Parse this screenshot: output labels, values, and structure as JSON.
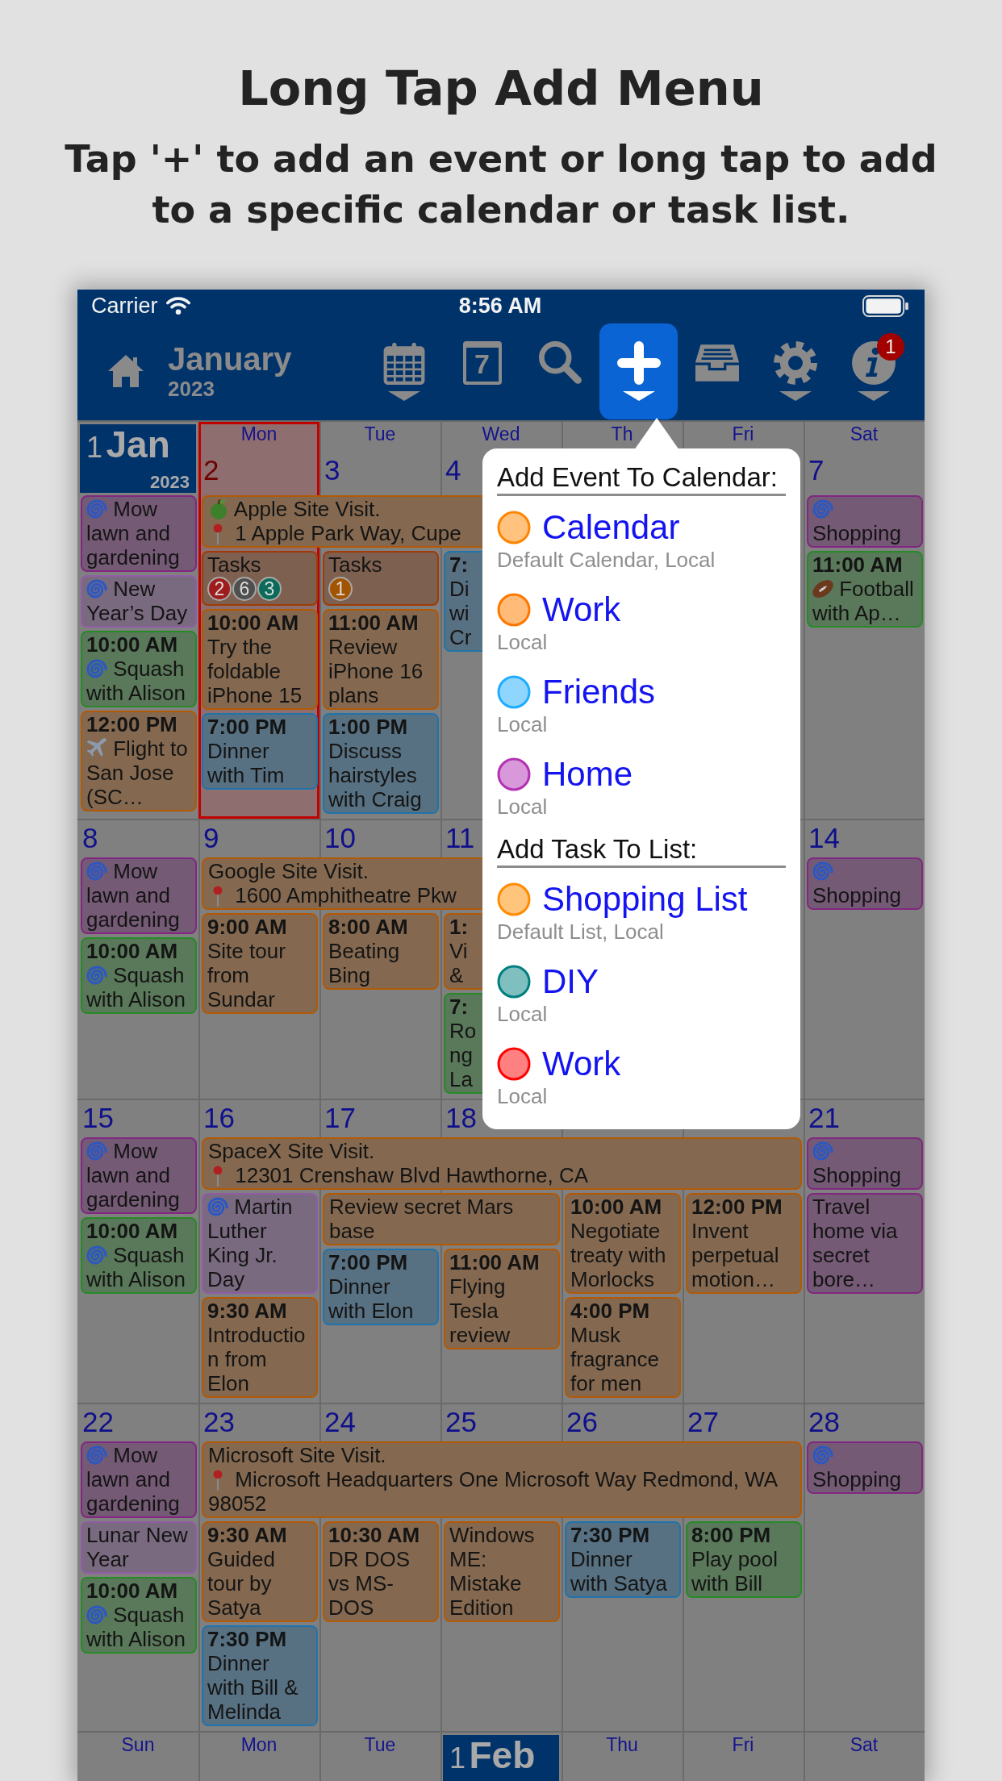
{
  "promo": {
    "title": "Long Tap Add Menu",
    "subtitle": "Tap '+' to add an event or long tap to add to a specific calendar or task list."
  },
  "status_bar": {
    "carrier": "Carrier",
    "time": "8:56 AM"
  },
  "toolbar": {
    "month": "January",
    "year": "2023",
    "buttons": [
      {
        "kind": "month-grid",
        "dropdown": true,
        "selected": false
      },
      {
        "kind": "day",
        "label": "7",
        "dropdown": false,
        "selected": false
      },
      {
        "kind": "search",
        "dropdown": false,
        "selected": false
      },
      {
        "kind": "add",
        "dropdown": true,
        "selected": true
      },
      {
        "kind": "inbox",
        "dropdown": false,
        "selected": false
      },
      {
        "kind": "settings",
        "dropdown": true,
        "selected": false
      },
      {
        "kind": "info",
        "dropdown": true,
        "selected": false,
        "badge": "1"
      }
    ]
  },
  "calendar": {
    "weeks": [
      {
        "days": [
          {
            "kind": "month-start",
            "day": "1",
            "month": "Jan",
            "year": "2023",
            "events": [
              {
                "kind": "cyclone-event",
                "title": "Mow lawn and gardening",
                "color": "#755a75"
              },
              {
                "kind": "cyclone-event",
                "title": "New Year’s Day",
                "color": "#7a6a80"
              },
              {
                "kind": "cyclone-event",
                "time": "10:00 AM",
                "title": "Squash with Alison",
                "color": "#5a785a"
              },
              {
                "kind": "airplane-event",
                "time": "12:00 PM",
                "title": "Flight to San Jose (SC…",
                "color": "#846950"
              }
            ]
          },
          {
            "kind": "day",
            "weekday": "Mon",
            "date": "2",
            "today": true,
            "banners": [
              {
                "kind": "apple-banner",
                "title": "Apple Site Visit.",
                "address": "1 Apple Park Way, Cupe",
                "color": "#846950"
              }
            ],
            "events": [
              {
                "kind": "tasks",
                "label": "Tasks",
                "color": "#7e6050",
                "counts": [
                  {
                    "count": "2",
                    "color": "#a01c1c"
                  },
                  {
                    "count": "6",
                    "color": "#4f4f4f"
                  },
                  {
                    "count": "3",
                    "color": "#0b6b5b"
                  }
                ]
              },
              {
                "kind": "event",
                "time": "10:00 AM",
                "title": "Try the foldable iPhone 15",
                "color": "#846950"
              },
              {
                "kind": "event",
                "time": "7:00 PM",
                "title": "Dinner with Tim",
                "color": "#587182"
              }
            ]
          },
          {
            "kind": "day",
            "weekday": "Tue",
            "date": "3",
            "today": false,
            "banners": [
              {
                "kind": "continued"
              }
            ],
            "events": [
              {
                "kind": "tasks",
                "label": "Tasks",
                "color": "#7e6050",
                "counts": [
                  {
                    "count": "1",
                    "color": "#a35400"
                  }
                ]
              },
              {
                "kind": "event",
                "time": "11:00 AM",
                "title": "Review iPhone 16 plans",
                "color": "#846950"
              },
              {
                "kind": "event",
                "time": "1:00 PM",
                "title": "Discuss hairstyles with Craig",
                "color": "#587182"
              }
            ]
          },
          {
            "kind": "day",
            "weekday": "Wed",
            "date": "4",
            "today": false,
            "banners": [
              {
                "kind": "continued"
              }
            ],
            "events": [
              {
                "kind": "event",
                "time": "7:",
                "title": "Di\nwi\nCr",
                "color": "#587182"
              }
            ]
          },
          {
            "kind": "day",
            "weekday": "Th"
          },
          {
            "kind": "day",
            "weekday": "Fri"
          },
          {
            "kind": "day",
            "weekday": "Sat",
            "date": "7",
            "today": false,
            "events": [
              {
                "kind": "cyclone-event",
                "title": "Shopping",
                "color": "#755a75"
              },
              {
                "kind": "football-event",
                "time": "11:00 AM",
                "title": "Football with Ap…",
                "color": "#5a785a"
              }
            ]
          }
        ]
      },
      {
        "days": [
          {
            "kind": "day",
            "date": "8",
            "today": false,
            "events": [
              {
                "kind": "cyclone-event",
                "title": "Mow lawn and gardening",
                "color": "#755a75"
              },
              {
                "kind": "cyclone-event",
                "time": "10:00 AM",
                "title": "Squash with Alison",
                "color": "#5a785a"
              }
            ]
          },
          {
            "kind": "day",
            "date": "9",
            "today": false,
            "banners": [
              {
                "kind": "banner",
                "title": "Google Site Visit.",
                "address": "1600 Amphitheatre Pkw",
                "color": "#846950"
              }
            ],
            "events": [
              {
                "kind": "event",
                "time": "9:00 AM",
                "title": "Site tour from Sundar",
                "color": "#846950"
              }
            ]
          },
          {
            "kind": "day",
            "date": "10",
            "today": false,
            "banners": [
              {
                "kind": "continued"
              }
            ],
            "events": [
              {
                "kind": "event",
                "time": "8:00 AM",
                "title": "Beating Bing",
                "color": "#846950"
              }
            ]
          },
          {
            "kind": "day",
            "date": "11",
            "today": false,
            "banners": [
              {
                "kind": "continued"
              }
            ],
            "events": [
              {
                "kind": "event",
                "time": "1:",
                "title": "Vi\n&",
                "color": "#846950"
              },
              {
                "kind": "event",
                "time": "7:",
                "title": "Ro\nng\nLa",
                "color": "#5a785a"
              }
            ]
          },
          {
            "kind": "day"
          },
          {
            "kind": "day"
          },
          {
            "kind": "day",
            "date": "14",
            "today": false,
            "events": [
              {
                "kind": "cyclone-event",
                "title": "Shopping",
                "color": "#755a75"
              }
            ]
          }
        ]
      },
      {
        "days": [
          {
            "kind": "day",
            "date": "15",
            "today": false,
            "events": [
              {
                "kind": "cyclone-event",
                "title": "Mow lawn and gardening",
                "color": "#755a75"
              },
              {
                "kind": "cyclone-event",
                "time": "10:00 AM",
                "title": "Squash with Alison",
                "color": "#5a785a"
              }
            ]
          },
          {
            "kind": "day",
            "date": "16",
            "today": false,
            "banners": [
              {
                "kind": "banner",
                "title": "SpaceX Site Visit.",
                "address": "12301 Crenshaw Blvd Hawthorne, CA",
                "color": "#846950"
              }
            ],
            "events": [
              {
                "kind": "cyclone-event",
                "title": "Martin Luther King Jr. Day",
                "color": "#7a6a80"
              },
              {
                "kind": "event",
                "time": "9:30 AM",
                "title": "Introduction from Elon",
                "color": "#846950"
              }
            ]
          },
          {
            "kind": "day",
            "date": "17",
            "today": false,
            "banners": [
              {
                "kind": "continued"
              },
              {
                "kind": "banner",
                "title": "Review secret Mars base",
                "color": "#846950"
              }
            ],
            "events": [
              {
                "kind": "event",
                "time": "7:00 PM",
                "title": "Dinner with Elon",
                "color": "#587182"
              }
            ]
          },
          {
            "kind": "day",
            "date": "18",
            "today": false,
            "banners": [
              {
                "kind": "continued"
              },
              {
                "kind": "continued"
              }
            ],
            "events": [
              {
                "kind": "event",
                "time": "11:00 AM",
                "title": "Flying Tesla review",
                "color": "#846950"
              }
            ]
          },
          {
            "kind": "day",
            "banners": [
              {
                "kind": "continued"
              }
            ],
            "events": [
              {
                "kind": "event",
                "time": "10:00 AM",
                "title": "Negotiate treaty with Morlocks",
                "color": "#846950"
              },
              {
                "kind": "event",
                "time": "4:00 PM",
                "title": "Musk fragrance for men",
                "color": "#846950"
              }
            ]
          },
          {
            "kind": "day",
            "banners": [
              {
                "kind": "continued"
              }
            ],
            "events": [
              {
                "kind": "event",
                "time": "12:00 PM",
                "title": "Invent perpetual motion…",
                "color": "#846950"
              }
            ]
          },
          {
            "kind": "day",
            "date": "21",
            "today": false,
            "events": [
              {
                "kind": "cyclone-event",
                "title": "Shopping",
                "color": "#755a75"
              },
              {
                "kind": "event",
                "title": "Travel home via secret bore…",
                "color": "#755a75"
              }
            ]
          }
        ]
      },
      {
        "days": [
          {
            "kind": "day",
            "date": "22",
            "today": false,
            "events": [
              {
                "kind": "cyclone-event",
                "title": "Mow lawn and gardening",
                "color": "#755a75"
              },
              {
                "kind": "event",
                "title": "Lunar New Year",
                "color": "#7a6a80"
              },
              {
                "kind": "cyclone-event",
                "time": "10:00 AM",
                "title": "Squash with Alison",
                "color": "#5a785a"
              }
            ]
          },
          {
            "kind": "day",
            "date": "23",
            "today": false,
            "banners": [
              {
                "kind": "banner",
                "title": "Microsoft Site Visit.",
                "address": "Microsoft Headquarters One Microsoft Way Redmond, WA 98052",
                "color": "#846950"
              }
            ],
            "events": [
              {
                "kind": "event",
                "time": "9:30 AM",
                "title": "Guided tour by Satya",
                "color": "#846950"
              },
              {
                "kind": "event",
                "time": "7:30 PM",
                "title": "Dinner with Bill & Melinda",
                "color": "#587182"
              }
            ]
          },
          {
            "kind": "day",
            "date": "24",
            "today": false,
            "banners": [
              {
                "kind": "continued"
              }
            ],
            "events": [
              {
                "kind": "event",
                "time": "10:30 AM",
                "title": "DR DOS vs MS-DOS",
                "color": "#846950"
              }
            ]
          },
          {
            "kind": "day",
            "date": "25",
            "today": false,
            "banners": [
              {
                "kind": "continued"
              }
            ],
            "events": [
              {
                "kind": "event",
                "title": "Windows ME: Mistake Edition",
                "color": "#846950"
              }
            ]
          },
          {
            "kind": "day",
            "date": "26",
            "today": false,
            "banners": [
              {
                "kind": "continued"
              }
            ],
            "events": [
              {
                "kind": "event",
                "time": "7:30 PM",
                "title": "Dinner with Satya",
                "color": "#587182"
              }
            ]
          },
          {
            "kind": "day",
            "date": "27",
            "today": false,
            "banners": [
              {
                "kind": "continued"
              }
            ],
            "events": [
              {
                "kind": "event",
                "time": "8:00 PM",
                "title": "Play pool with Bill",
                "color": "#5a785a"
              }
            ]
          },
          {
            "kind": "day",
            "date": "28",
            "today": false,
            "events": [
              {
                "kind": "cyclone-event",
                "title": "Shopping",
                "color": "#755a75"
              }
            ]
          }
        ]
      },
      {
        "days": [
          {
            "kind": "day",
            "weekday": "Sun"
          },
          {
            "kind": "day",
            "weekday": "Mon"
          },
          {
            "kind": "day",
            "weekday": "Tue"
          },
          {
            "kind": "month-start",
            "day": "1",
            "month": "Feb"
          },
          {
            "kind": "day",
            "weekday": "Thu"
          },
          {
            "kind": "day",
            "weekday": "Fri"
          },
          {
            "kind": "day",
            "weekday": "Sat"
          }
        ]
      }
    ]
  },
  "popover": {
    "sections": [
      {
        "heading": "Add Event To Calendar:",
        "items": [
          {
            "name": "Calendar",
            "detail": "Default Calendar, Local",
            "color": "#ffc27f"
          },
          {
            "name": "Work",
            "detail": "Local",
            "color": "#ffbb77"
          },
          {
            "name": "Friends",
            "detail": "Local",
            "color": "#8fd6ff"
          },
          {
            "name": "Home",
            "detail": "Local",
            "color": "#d998d9"
          }
        ]
      },
      {
        "heading": "Add Task To List:",
        "items": [
          {
            "name": "Shopping List",
            "detail": "Default List, Local",
            "color": "#ffc57c"
          },
          {
            "name": "DIY",
            "detail": "Local",
            "color": "#80bfbf"
          },
          {
            "name": "Work",
            "detail": "Local",
            "color": "#ff8080"
          }
        ]
      }
    ]
  }
}
